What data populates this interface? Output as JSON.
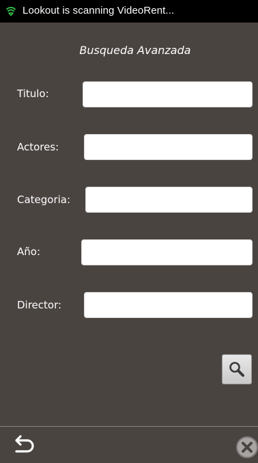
{
  "status_bar": {
    "notification_text": "Lookout is scanning VideoRent...",
    "icon": "lookout-shield-icon",
    "icon_color": "#3cc84a"
  },
  "form": {
    "title": "Busqueda Avanzada",
    "fields": [
      {
        "label": "Titulo:",
        "value": ""
      },
      {
        "label": "Actores:",
        "value": ""
      },
      {
        "label": "Categoria:",
        "value": ""
      },
      {
        "label": "Año:",
        "value": ""
      },
      {
        "label": "Director:",
        "value": ""
      }
    ],
    "search_icon": "magnifier-icon"
  },
  "nav_bar": {
    "back_icon": "back-arrow-icon",
    "close_icon": "close-circle-icon"
  },
  "colors": {
    "background": "#4a4441",
    "status_bar": "#000000",
    "input_background": "#ffffff",
    "text": "#ffffff"
  }
}
